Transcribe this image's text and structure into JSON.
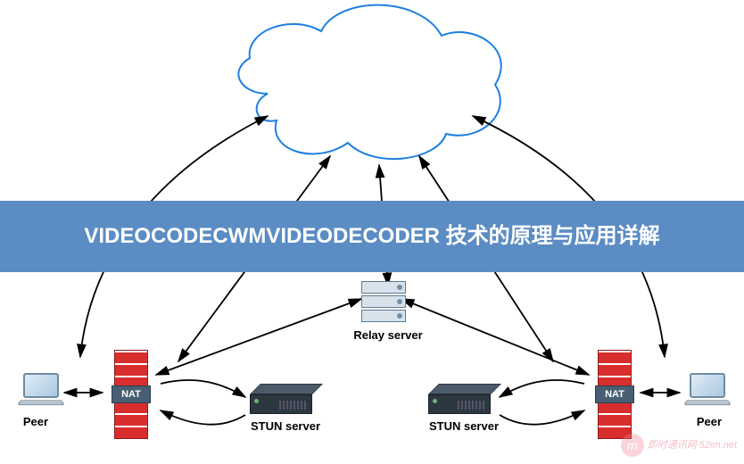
{
  "banner_text": "VIDEOCODECWMVIDEODECODER 技术的原理与应用详解",
  "nodes": {
    "cloud": {
      "label": ""
    },
    "relay": {
      "label": "Relay server"
    },
    "peer_left": {
      "label": "Peer"
    },
    "peer_right": {
      "label": "Peer"
    },
    "nat_left": {
      "label": "NAT"
    },
    "nat_right": {
      "label": "NAT"
    },
    "stun_left": {
      "label": "STUN server"
    },
    "stun_right": {
      "label": "STUN server"
    }
  },
  "watermark": {
    "logo": "m",
    "text": "即时通讯网 52im.net"
  }
}
